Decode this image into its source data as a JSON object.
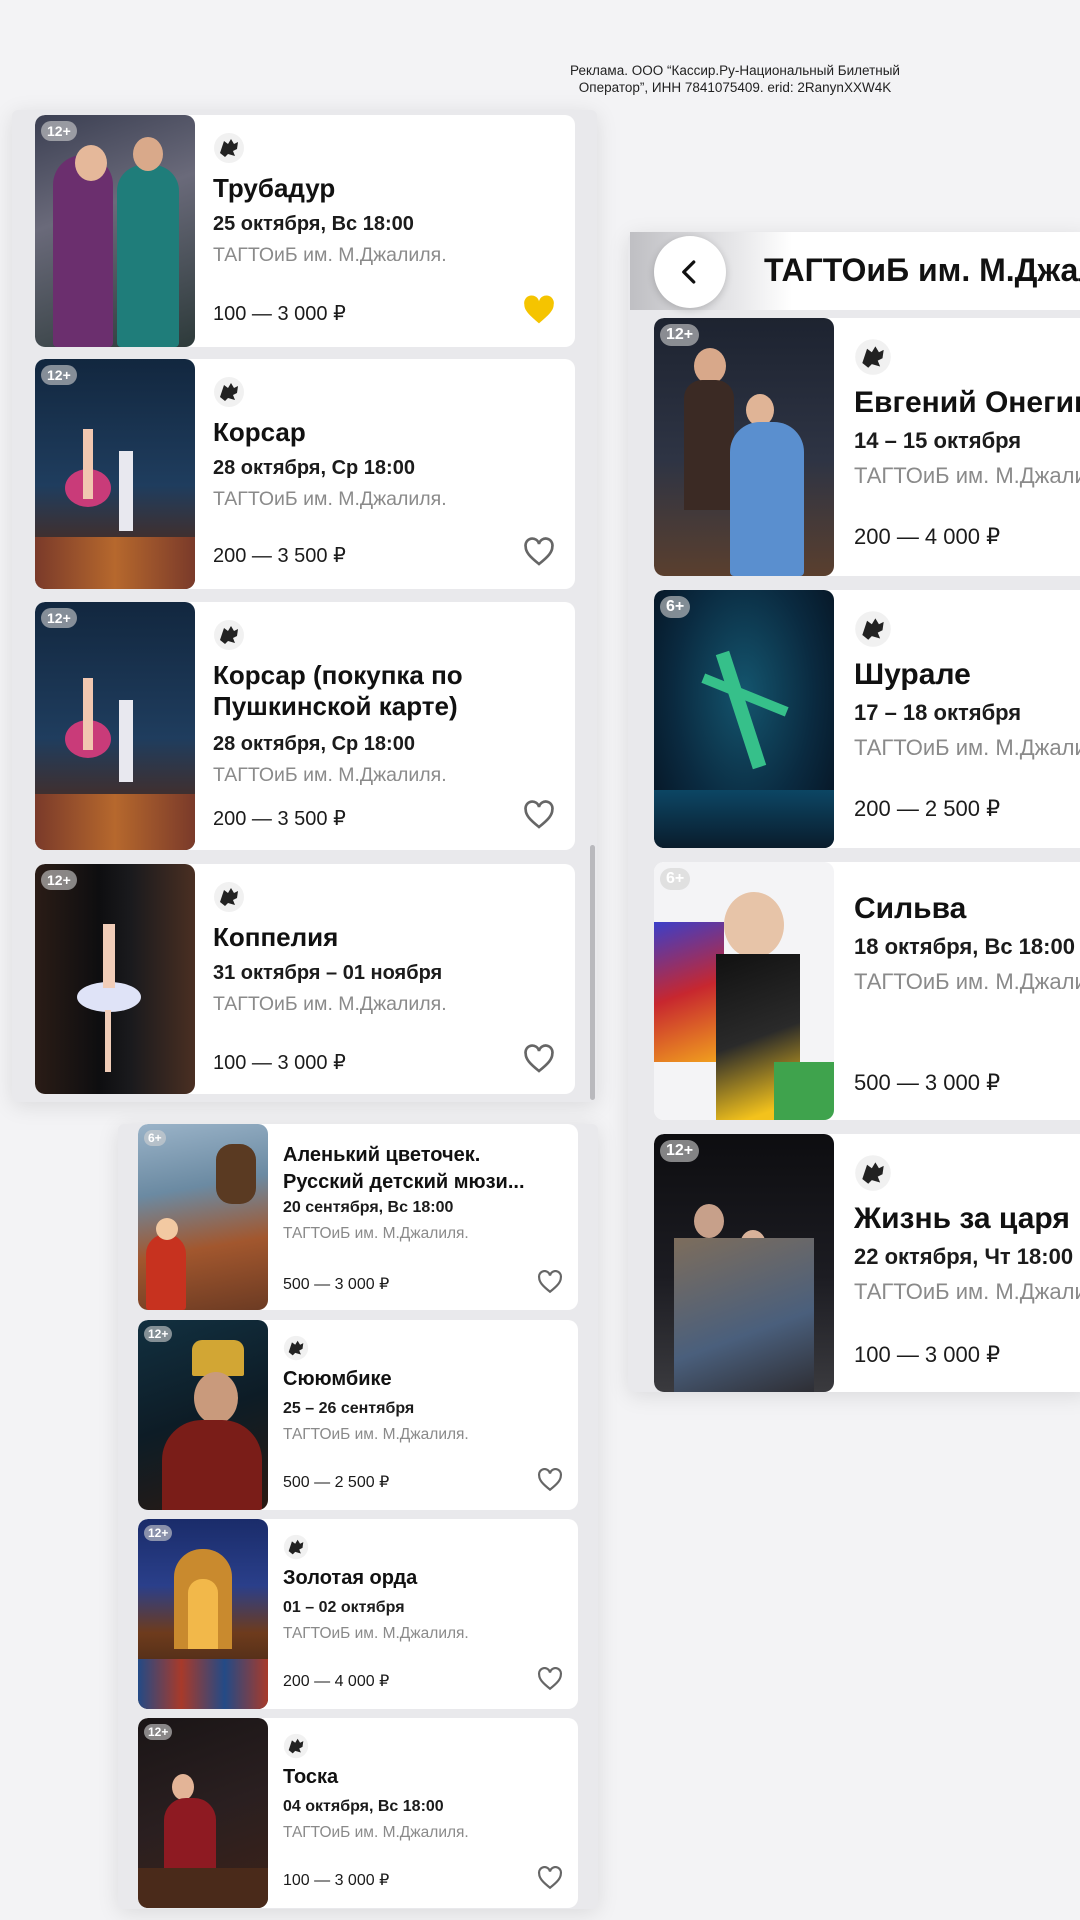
{
  "ad_text": {
    "line1": "Реклама. ООО “Кассир.Ру-Национальный Билетный",
    "line2": "Оператор”, ИНН 7841075409. erid: 2RanynXXW4K"
  },
  "icons": {
    "organizer": "lion-head-icon",
    "favorite": "heart-icon",
    "back": "chevron-left-icon"
  },
  "colors": {
    "heart_active": "#f5c400",
    "heart_inactive": "#666666"
  },
  "right_header": {
    "title": "ТАГТОиБ им. М.Джалиля."
  },
  "left_list": [
    {
      "title": "Трубадур",
      "date": "25 октября, Вс 18:00",
      "venue": "ТАГТОиБ им. М.Джалиля.",
      "price": "100 — 3 000 ₽",
      "age": "12+",
      "favorite": true
    },
    {
      "title": "Корсар",
      "date": "28 октября, Ср 18:00",
      "venue": "ТАГТОиБ им. М.Джалиля.",
      "price": "200 — 3 500 ₽",
      "age": "12+",
      "favorite": false
    },
    {
      "title_line1": "Корсар (покупка по",
      "title_line2": "Пушкинской карте)",
      "date": "28 октября, Ср 18:00",
      "venue": "ТАГТОиБ им. М.Джалиля.",
      "price": "200 — 3 500 ₽",
      "age": "12+",
      "favorite": false
    },
    {
      "title": "Коппелия",
      "date": "31 октября – 01 ноября",
      "venue": "ТАГТОиБ им. М.Джалиля.",
      "price": "100 — 3 000 ₽",
      "age": "12+",
      "favorite": false
    }
  ],
  "bottom_list": [
    {
      "title_line1": "Аленький цветочек.",
      "title_line2": "Русский детский мюзи...",
      "date": "20 сентября, Вс 18:00",
      "venue": "ТАГТОиБ им. М.Джалиля.",
      "price": "500 — 3 000 ₽",
      "age": "6+",
      "favorite": false
    },
    {
      "title": "Сююмбике",
      "date": "25 – 26 сентября",
      "venue": "ТАГТОиБ им. М.Джалиля.",
      "price": "500 — 2 500 ₽",
      "age": "12+",
      "favorite": false
    },
    {
      "title": "Золотая орда",
      "date": "01 – 02 октября",
      "venue": "ТАГТОиБ им. М.Джалиля.",
      "price": "200 — 4 000 ₽",
      "age": "12+",
      "favorite": false
    },
    {
      "title": "Тоска",
      "date": "04 октября, Вс 18:00",
      "venue": "ТАГТОиБ им. М.Джалиля.",
      "price": "100 — 3 000 ₽",
      "age": "12+",
      "favorite": false
    }
  ],
  "right_list": [
    {
      "title": "Евгений Онегин",
      "date": "14 – 15 октября",
      "venue": "ТАГТОиБ им. М.Джалиля.",
      "price": "200 — 4 000 ₽",
      "age": "12+"
    },
    {
      "title": "Шурале",
      "date": "17 – 18 октября",
      "venue": "ТАГТОиБ им. М.Джалиля.",
      "price": "200 — 2 500 ₽",
      "age": "6+"
    },
    {
      "title": "Сильва",
      "date": "18 октября, Вс 18:00",
      "venue": "ТАГТОиБ им. М.Джалиля.",
      "price": "500 — 3 000 ₽",
      "age": "6+"
    },
    {
      "title": "Жизнь за царя",
      "date": "22 октября, Чт 18:00",
      "venue": "ТАГТОиБ им. М.Джалиля.",
      "price": "100 — 3 000 ₽",
      "age": "12+"
    }
  ]
}
